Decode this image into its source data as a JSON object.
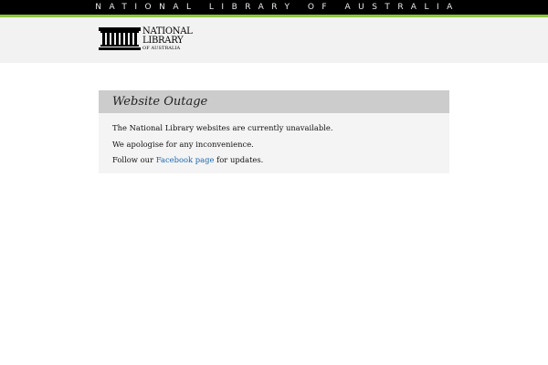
{
  "top_bar": {
    "text": "NATIONAL LIBRARY OF AUSTRALIA"
  },
  "logo": {
    "line1": "NATIONAL",
    "line2": "LIBRARY",
    "line3": "OF AUSTRALIA"
  },
  "notice": {
    "title": "Website Outage",
    "line1": "The National Library websites are currently unavailable.",
    "line2": "We apologise for any inconvenience.",
    "line3_prefix": "Follow our ",
    "line3_link": "Facebook page",
    "line3_suffix": " for updates."
  },
  "colors": {
    "top_bar": "#000000",
    "accent": "#8cc63f",
    "header_bg": "#f2f2f2",
    "panel_head": "#cccccc",
    "panel_body": "#f4f4f4",
    "link": "#1a66b0"
  }
}
